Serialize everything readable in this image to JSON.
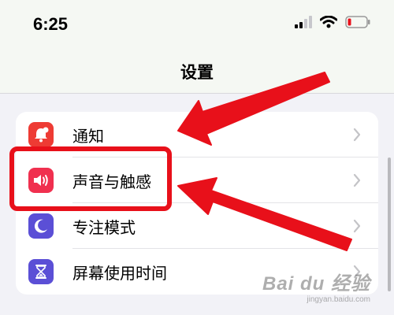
{
  "status_bar": {
    "time": "6:25",
    "icons": [
      "cellular-signal-icon",
      "wifi-icon",
      "battery-low-icon"
    ],
    "battery_color": "#e8101a"
  },
  "nav": {
    "title": "设置"
  },
  "settings": {
    "items": [
      {
        "label": "通知",
        "icon": "notifications-icon",
        "color": "#ee3b34"
      },
      {
        "label": "声音与触感",
        "icon": "speaker-icon",
        "color": "#f0304f"
      },
      {
        "label": "专注模式",
        "icon": "moon-icon",
        "color": "#5b4fd6"
      },
      {
        "label": "屏幕使用时间",
        "icon": "hourglass-icon",
        "color": "#5b4fd6"
      }
    ]
  },
  "annotation": {
    "highlight_color": "#e8101a",
    "highlighted_item": "声音与触感"
  },
  "watermark": {
    "main": "Bai du 经验",
    "sub": "jingyan.baidu.com"
  }
}
